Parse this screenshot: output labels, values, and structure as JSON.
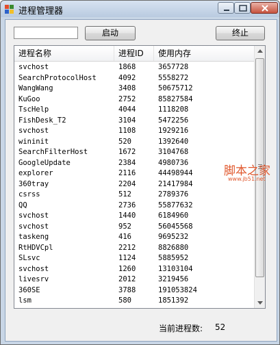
{
  "window": {
    "title": "进程管理器"
  },
  "toolbar": {
    "search_value": "",
    "start_label": "启动",
    "stop_label": "终止"
  },
  "list": {
    "columns": [
      "进程名称",
      "进程ID",
      "使用内存"
    ],
    "rows": [
      {
        "name": "svchost",
        "pid": "1868",
        "mem": "3657728"
      },
      {
        "name": "SearchProtocolHost",
        "pid": "4092",
        "mem": "5558272"
      },
      {
        "name": "WangWang",
        "pid": "3408",
        "mem": "50675712"
      },
      {
        "name": "KuGoo",
        "pid": "2752",
        "mem": "85827584"
      },
      {
        "name": "TscHelp",
        "pid": "4044",
        "mem": "1118208"
      },
      {
        "name": "FishDesk_T2",
        "pid": "3104",
        "mem": "5472256"
      },
      {
        "name": "svchost",
        "pid": "1108",
        "mem": "1929216"
      },
      {
        "name": "wininit",
        "pid": "520",
        "mem": "1392640"
      },
      {
        "name": "SearchFilterHost",
        "pid": "1672",
        "mem": "3104768"
      },
      {
        "name": "GoogleUpdate",
        "pid": "2384",
        "mem": "4980736"
      },
      {
        "name": "explorer",
        "pid": "2116",
        "mem": "44498944"
      },
      {
        "name": "360tray",
        "pid": "2204",
        "mem": "21417984"
      },
      {
        "name": "csrss",
        "pid": "512",
        "mem": "2789376"
      },
      {
        "name": "QQ",
        "pid": "2736",
        "mem": "55877632"
      },
      {
        "name": "svchost",
        "pid": "1440",
        "mem": "6184960"
      },
      {
        "name": "svchost",
        "pid": "952",
        "mem": "56045568"
      },
      {
        "name": "taskeng",
        "pid": "416",
        "mem": "9695232"
      },
      {
        "name": "RtHDVCpl",
        "pid": "2212",
        "mem": "8826880"
      },
      {
        "name": "SLsvc",
        "pid": "1124",
        "mem": "5885952"
      },
      {
        "name": "svchost",
        "pid": "1260",
        "mem": "13103104"
      },
      {
        "name": "livesrv",
        "pid": "2012",
        "mem": "3219456"
      },
      {
        "name": "360SE",
        "pid": "3788",
        "mem": "191053824"
      },
      {
        "name": "lsm",
        "pid": "580",
        "mem": "1851392"
      }
    ]
  },
  "status": {
    "count_label": "当前进程数:",
    "count_value": "52"
  },
  "watermark": {
    "title": "脚本之家",
    "url": "www.jb51.net"
  },
  "colors": {
    "title_bar": "#c8d6e6",
    "close_button": "#c7533f",
    "watermark": "#e0572c"
  },
  "icons": [
    "app-icon",
    "minimize-icon",
    "maximize-icon",
    "close-icon",
    "scroll-up-icon",
    "scroll-down-icon"
  ]
}
